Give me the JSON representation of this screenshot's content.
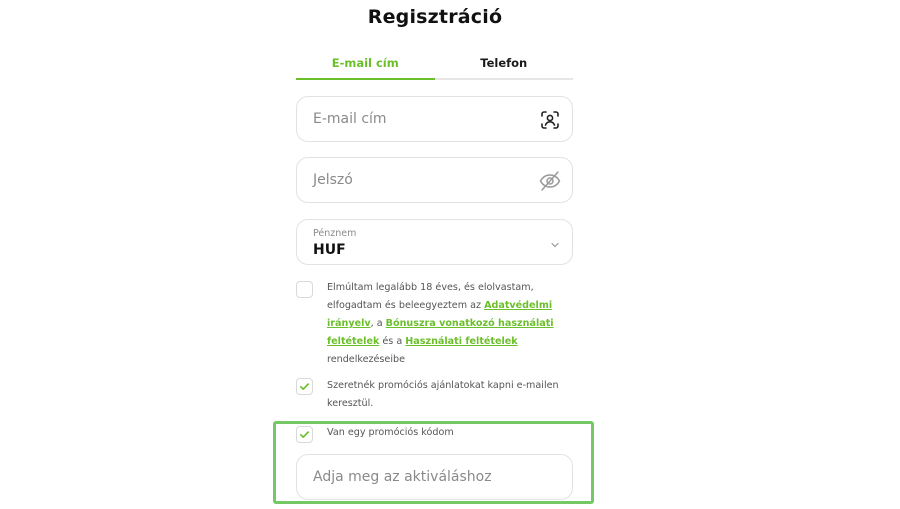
{
  "title": "Regisztráció",
  "tabs": [
    {
      "label": "E-mail cím",
      "active": true
    },
    {
      "label": "Telefon",
      "active": false
    }
  ],
  "email": {
    "placeholder": "E-mail cím",
    "icon": "scan-user-icon"
  },
  "password": {
    "placeholder": "Jelszó",
    "icon": "eye-off-icon"
  },
  "currency": {
    "label": "Pénznem",
    "value": "HUF",
    "icon": "chevron-down-icon"
  },
  "consent": {
    "checked": false,
    "text_1": "Elmúltam legalább 18 éves, és elolvastam, elfogadtam és beleegyeztem az ",
    "link_privacy": "Adatvédelmi irányelv",
    "text_2": ", a ",
    "link_bonus": "Bónuszra vonatkozó használati feltételek",
    "text_3": " és a ",
    "link_terms": "Használati feltételek",
    "text_4": " rendelkezéseibe"
  },
  "promo_email": {
    "checked": true,
    "text": "Szeretnék promóciós ajánlatokat kapni e-mailen keresztül."
  },
  "promo_code": {
    "checked": true,
    "text": "Van egy promóciós kódom",
    "placeholder": "Adja meg az aktiváláshoz"
  },
  "colors": {
    "accent": "#6bbf2a",
    "highlight": "#74c865",
    "border": "#e2e2e2"
  }
}
